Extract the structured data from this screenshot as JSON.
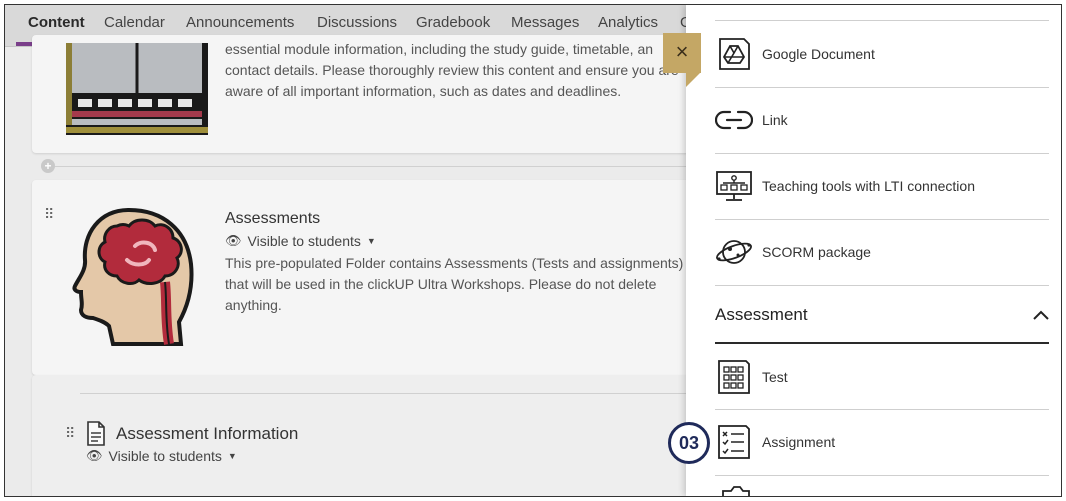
{
  "nav": {
    "tabs": [
      {
        "label": "Content"
      },
      {
        "label": "Calendar"
      },
      {
        "label": "Announcements"
      },
      {
        "label": "Discussions"
      },
      {
        "label": "Gradebook"
      },
      {
        "label": "Messages"
      },
      {
        "label": "Analytics"
      },
      {
        "label": "G"
      }
    ],
    "active": "Content",
    "accent_color": "#7a3e8a"
  },
  "content": {
    "info_text": "essential module information, including the study guide, timetable, an contact details. Please thoroughly review this content and ensure you are aware of all important information, such as dates and deadlines.",
    "assessments": {
      "title": "Assessments",
      "visibility": "Visible to students",
      "description": "This pre-populated Folder contains Assessments (Tests and assignments) that will be used in the clickUP Ultra Workshops. Please do not delete anything."
    },
    "assessment_info": {
      "title": "Assessment Information",
      "visibility": "Visible to students"
    }
  },
  "panel": {
    "close_label": "×",
    "items": [
      {
        "label": "Google Document",
        "icon": "google-drive-icon"
      },
      {
        "label": "Link",
        "icon": "link-icon"
      },
      {
        "label": "Teaching tools with LTI connection",
        "icon": "lti-tool-icon"
      },
      {
        "label": "SCORM package",
        "icon": "scorm-icon"
      }
    ],
    "assessment_section": {
      "title": "Assessment",
      "items": [
        {
          "label": "Test",
          "icon": "test-icon"
        },
        {
          "label": "Assignment",
          "icon": "assignment-icon"
        }
      ]
    }
  },
  "step_badge": "03",
  "colors": {
    "close_button": "#c4a765",
    "badge": "#1f2a5a"
  }
}
